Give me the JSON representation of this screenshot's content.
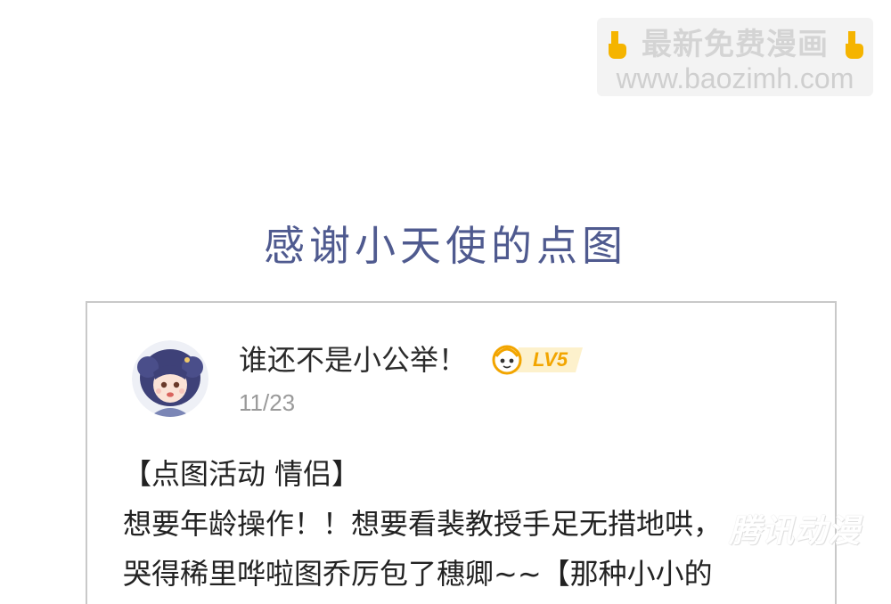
{
  "watermark_top": {
    "line1": "最新免费漫画",
    "line2": "www.baozimh.com",
    "hand_icon_color": "#f5b400"
  },
  "section_title": "感谢小天使的点图",
  "comment": {
    "username": "谁还不是小公举！",
    "level": "LV5",
    "date": "11/23",
    "body_lines": [
      "【点图活动 情侣】",
      "想要年龄操作！！想要看裴教授手足无措地哄，",
      "哭得稀里哗啦图乔厉包了穗卿~~【那种小小的"
    ]
  },
  "watermark_bottom": "腾讯动漫",
  "colors": {
    "title": "#4f5a8f",
    "card_border": "#c9c9c9",
    "level_badge": "#f2a500",
    "date": "#9a9a9a"
  }
}
